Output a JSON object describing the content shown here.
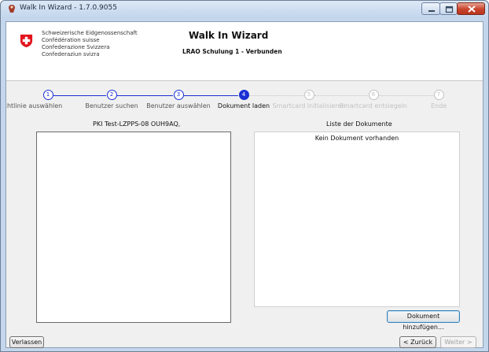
{
  "window": {
    "title": "Walk In Wizard - 1.7.0.9055"
  },
  "header": {
    "gov_lines": [
      "Schweizerische Eidgenossenschaft",
      "Confédération suisse",
      "Confederazione Svizzera",
      "Confederaziun svizra"
    ],
    "app_title": "Walk In Wizard",
    "status": "LRAO Schulung 1 - Verbunden"
  },
  "steps": [
    {
      "num": "1",
      "label": "Richtlinie auswählen",
      "state": "done"
    },
    {
      "num": "2",
      "label": "Benutzer suchen",
      "state": "done"
    },
    {
      "num": "3",
      "label": "Benutzer auswählen",
      "state": "done"
    },
    {
      "num": "4",
      "label": "Dokument laden",
      "state": "current"
    },
    {
      "num": "5",
      "label": "Smartcard initialisieren",
      "state": "pending"
    },
    {
      "num": "6",
      "label": "Smartcard entsiegeln",
      "state": "pending"
    },
    {
      "num": "7",
      "label": "Ende",
      "state": "pending"
    }
  ],
  "left_panel": {
    "title": "PKI Test-LZPPS-08 OUH9AQ,"
  },
  "right_panel": {
    "title": "Liste der Dokumente",
    "empty_message": "Kein Dokument vorhanden",
    "add_button": "Dokument hinzufügen..."
  },
  "footer": {
    "leave_button": "Verlassen",
    "back_button": "< Zurück",
    "next_button": "Weiter >"
  },
  "colors": {
    "step_active": "#1a2fd4",
    "step_pending": "#c2c2c2"
  }
}
